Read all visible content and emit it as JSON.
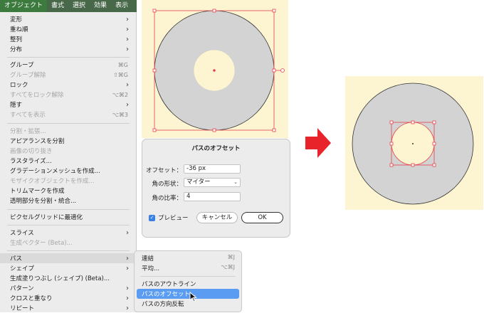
{
  "menubar": {
    "items": [
      "オブジェクト",
      "書式",
      "選択",
      "効果",
      "表示"
    ],
    "active_index": 0
  },
  "menu": {
    "items": [
      {
        "label": "変形",
        "submenu": true
      },
      {
        "label": "重ね順",
        "submenu": true
      },
      {
        "label": "整列",
        "submenu": true
      },
      {
        "label": "分布",
        "submenu": true
      },
      {
        "label": "グループ",
        "shortcut": "⌘G"
      },
      {
        "label": "グループ解除",
        "shortcut": "⇧⌘G",
        "disabled": true
      },
      {
        "label": "ロック",
        "submenu": true
      },
      {
        "label": "すべてをロック解除",
        "shortcut": "⌥⌘2",
        "disabled": true
      },
      {
        "label": "隠す",
        "submenu": true
      },
      {
        "label": "すべてを表示",
        "shortcut": "⌥⌘3",
        "disabled": true
      },
      {
        "label": "分割・拡張...",
        "disabled": true
      },
      {
        "label": "アピアランスを分割"
      },
      {
        "label": "画像の切り抜き",
        "disabled": true
      },
      {
        "label": "ラスタライズ..."
      },
      {
        "label": "グラデーションメッシュを作成..."
      },
      {
        "label": "モザイクオブジェクトを作成...",
        "disabled": true
      },
      {
        "label": "トリムマークを作成"
      },
      {
        "label": "透明部分を分割・統合..."
      },
      {
        "label": "ピクセルグリッドに最適化"
      },
      {
        "label": "スライス",
        "submenu": true
      },
      {
        "label": "生成ベクター (Beta)...",
        "disabled": true
      },
      {
        "label": "パス",
        "submenu": true,
        "highlighted": true
      },
      {
        "label": "シェイプ",
        "submenu": true
      },
      {
        "label": "生成塗りつぶし (シェイプ) (Beta)..."
      },
      {
        "label": "パターン",
        "submenu": true
      },
      {
        "label": "クロスと重なり",
        "submenu": true
      },
      {
        "label": "リピート",
        "submenu": true
      }
    ]
  },
  "submenu": {
    "items": [
      {
        "label": "連結",
        "shortcut": "⌘J"
      },
      {
        "label": "平均...",
        "shortcut": "⌥⌘J"
      },
      {
        "label": "パスのアウトライン"
      },
      {
        "label": "パスのオフセット...",
        "selected": true
      },
      {
        "label": "パスの方向反転"
      }
    ]
  },
  "dialog": {
    "title": "パスのオフセット",
    "offset_label": "オフセット：",
    "offset_value": "-36 px",
    "join_label": "角の形状：",
    "join_value": "マイター",
    "limit_label": "角の比率：",
    "limit_value": "4",
    "preview_label": "プレビュー",
    "preview_checked": true,
    "cancel_label": "キャンセル",
    "ok_label": "OK"
  },
  "colors": {
    "menubar_bg": "#48684a",
    "artboard_bg": "#fdf5d2",
    "shape_fill": "#d3d3d3",
    "selection": "#e8404a",
    "arrow": "#e8232a",
    "selected_item": "#5a9cf2"
  },
  "icons": {
    "submenu_arrow": "chevron-right-icon",
    "arrow": "right-arrow-icon",
    "cursor": "mouse-pointer-icon",
    "checkbox": "checkmark-icon"
  }
}
